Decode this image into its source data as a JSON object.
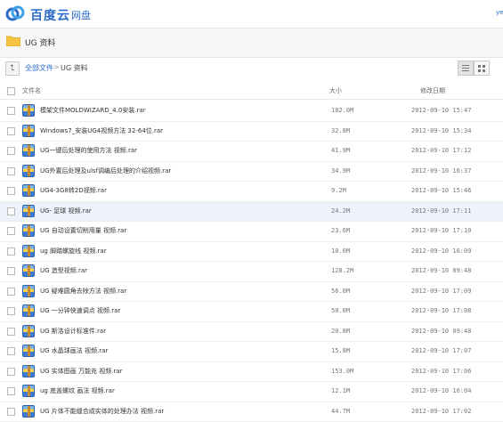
{
  "header": {
    "logo_text": "百度云",
    "logo_sub": "网盘",
    "user": "ye"
  },
  "folder": {
    "title": "UG 资料"
  },
  "breadcrumb": {
    "all_files": "全部文件",
    "separator": ">",
    "current": "UG 资料"
  },
  "table": {
    "columns": {
      "name": "文件名",
      "size": "大小",
      "date": "修改日期"
    },
    "rows": [
      {
        "name": "模架文件MOLDWIZARD_4.0安装.rar",
        "size": "182.0M",
        "date": "2012-09-10 15:47"
      },
      {
        "name": "Windows7_安装UG4视频方法 32-64位.rar",
        "size": "32.8M",
        "date": "2012-09-10 15:34"
      },
      {
        "name": "UG一键后处理的使用方法 视频.rar",
        "size": "41.9M",
        "date": "2012-09-10 17:12"
      },
      {
        "name": "UG外置后处理及ulsf调编后处理的介绍视频.rar",
        "size": "34.9M",
        "date": "2012-09-10 16:37"
      },
      {
        "name": "UG4-3G8转2D视频.rar",
        "size": "9.2M",
        "date": "2012-09-10 15:46"
      },
      {
        "name": "UG- 足球 视频.rar",
        "size": "24.2M",
        "date": "2012-09-10 17:11"
      },
      {
        "name": "UG 自动设置切削用量 视频.rar",
        "size": "23.6M",
        "date": "2012-09-10 17:10"
      },
      {
        "name": "ug 脚踏螺旋线 视频.rar",
        "size": "10.0M",
        "date": "2012-09-10 16:09"
      },
      {
        "name": "UG 造型视频.rar",
        "size": "128.2M",
        "date": "2012-09-10 09:48"
      },
      {
        "name": "UG 疑难圆角去除方法 视频.rar",
        "size": "56.0M",
        "date": "2012-09-10 17:09"
      },
      {
        "name": "UG 一分钟快速调点 视频.rar",
        "size": "50.0M",
        "date": "2012-09-10 17:08"
      },
      {
        "name": "UG 斯洛设计标准件.rar",
        "size": "20.8M",
        "date": "2012-09-10 09:48"
      },
      {
        "name": "UG 水晶球画法 视频.rar",
        "size": "15.8M",
        "date": "2012-09-10 17:07"
      },
      {
        "name": "UG 实体图画 万能充 视频.rar",
        "size": "153.0M",
        "date": "2012-09-10 17:06"
      },
      {
        "name": "ug 底盖螺纹 画法 视频.rar",
        "size": "12.1M",
        "date": "2012-09-10 16:04"
      },
      {
        "name": "UG 片体不能缝合成实体的处理办法 视频.rar",
        "size": "44.7M",
        "date": "2012-09-10 17:02"
      }
    ],
    "highlighted_row": 5
  },
  "colors": {
    "accent": "#2b6cc9",
    "highlight_row": "#eef3fb"
  },
  "icons": [
    "baidu-cloud-logo-icon",
    "folder-icon",
    "back-arrow-icon",
    "list-view-icon",
    "grid-view-icon",
    "rar-archive-icon"
  ]
}
